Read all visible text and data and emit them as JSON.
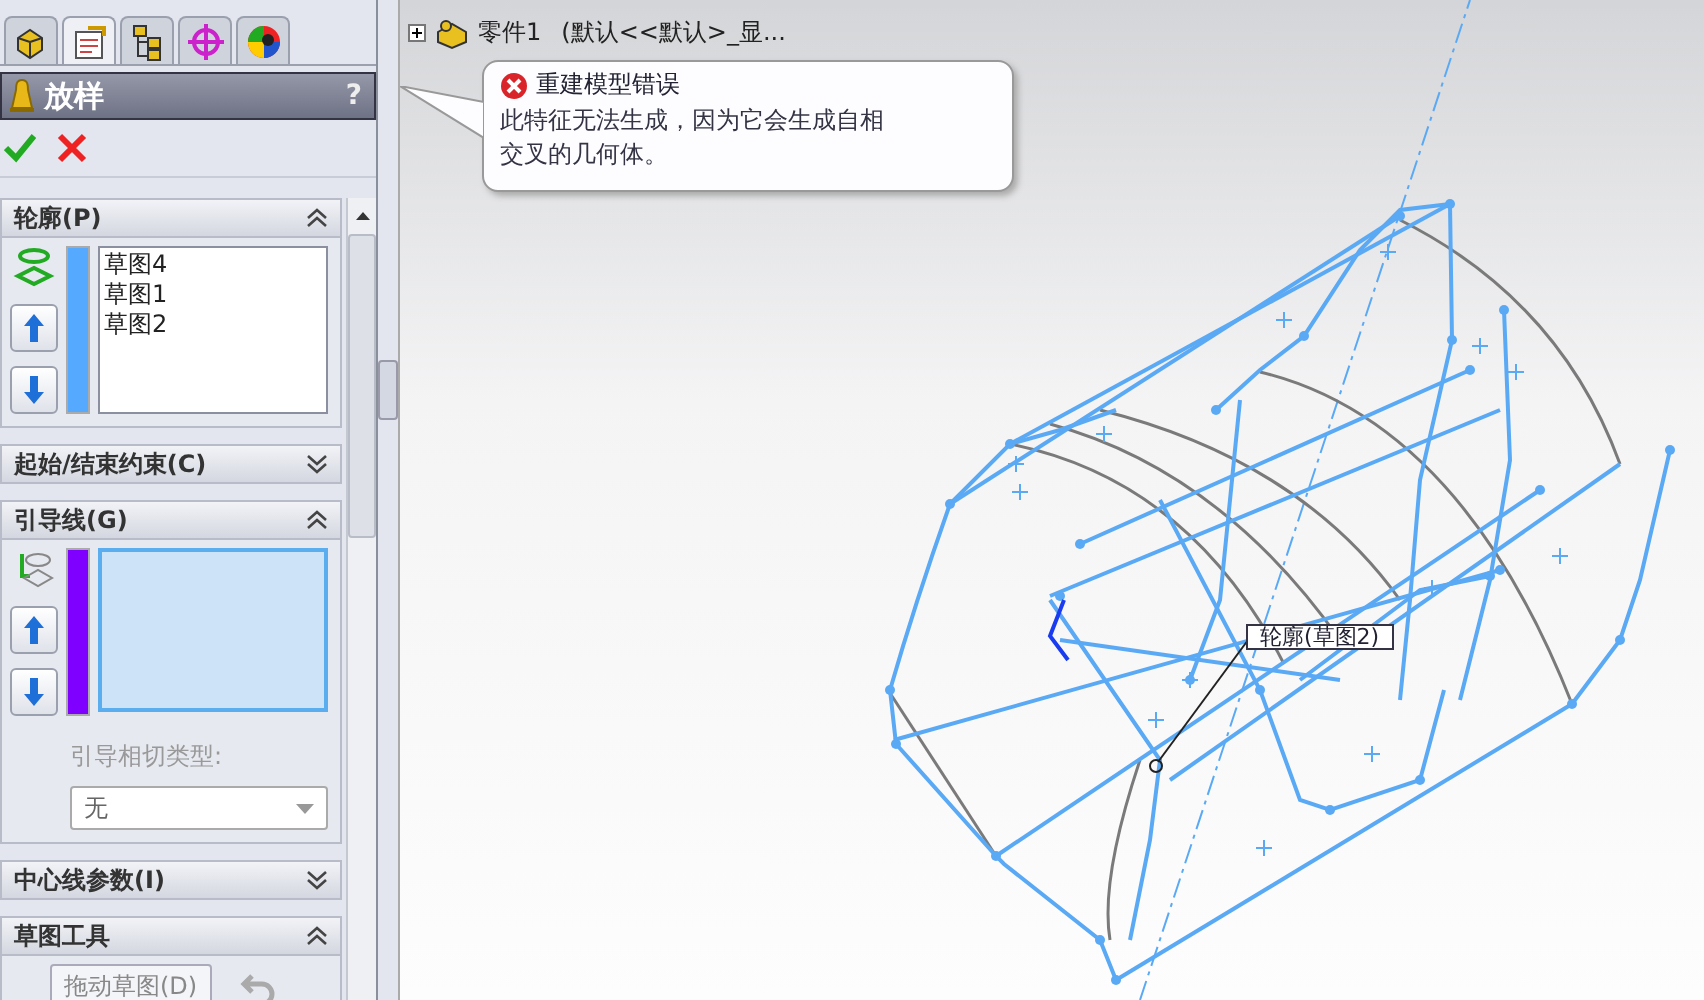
{
  "feature_tabs": [
    {
      "selected": false
    },
    {
      "selected": true
    },
    {
      "selected": false
    },
    {
      "selected": false
    },
    {
      "selected": false
    }
  ],
  "property_manager": {
    "title": "放样",
    "help": "?"
  },
  "sections": [
    {
      "kind": "list",
      "title": "轮廓(P)",
      "expanded": true,
      "color": "#55aaff",
      "items": [
        "草图4",
        "草图1",
        "草图2"
      ]
    },
    {
      "kind": "plain",
      "title": "起始/结束约束(C)",
      "expanded": false
    },
    {
      "kind": "list",
      "title": "引导线(G)",
      "expanded": true,
      "color": "#8000ff",
      "tangency_label": "引导相切类型:",
      "tangency_value": "无"
    },
    {
      "kind": "plain",
      "title": "中心线参数(I)",
      "expanded": false
    },
    {
      "kind": "tools",
      "title": "草图工具",
      "expanded": true,
      "button": "拖动草图(D)"
    }
  ],
  "tree": {
    "part": "零件1",
    "config": "(默认<<默认>_显..."
  },
  "error_tooltip": {
    "title": "重建模型错误",
    "message": "此特征无法生成，因为它会生成自相交叉的几何体。"
  },
  "callout": "轮廓(草图2)"
}
